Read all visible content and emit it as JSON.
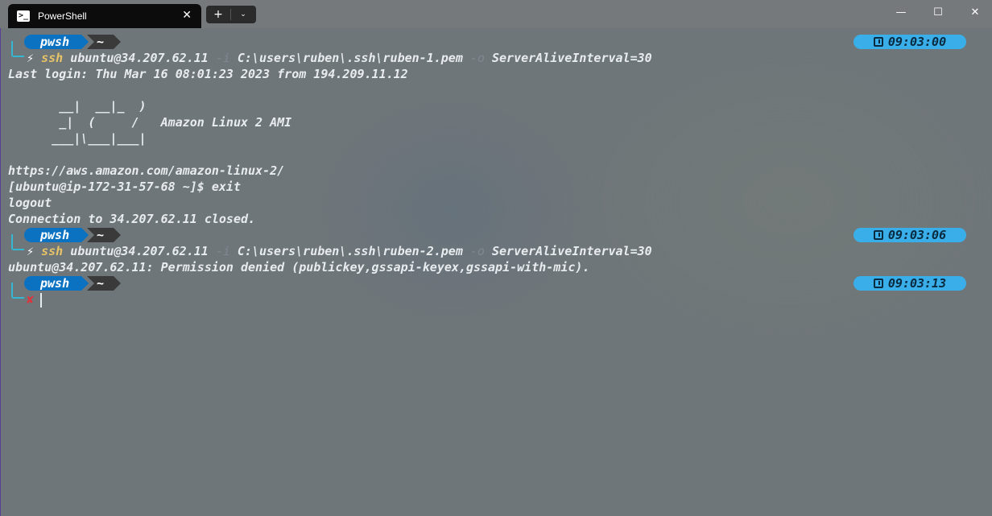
{
  "window": {
    "tab_title": "PowerShell",
    "tab_icon_glyph": ">_",
    "tab_close": "✕",
    "new_tab": "+",
    "dropdown": "⌄",
    "minimize": "—",
    "maximize": "☐",
    "close": "✕"
  },
  "prompt": {
    "shell": "pwsh",
    "path": "~",
    "ok_glyph": "⚡",
    "err_glyph": "✘"
  },
  "blocks": [
    {
      "time": "09:03:00",
      "command": {
        "name": "ssh",
        "target": "ubuntu@34.207.62.11",
        "flag1": "-i",
        "arg1": "C:\\users\\ruben\\.ssh\\ruben-1.pem",
        "flag2": "-o",
        "arg2": "ServerAliveInterval=30"
      }
    },
    {
      "time": "09:03:06",
      "command": {
        "name": "ssh",
        "target": "ubuntu@34.207.62.11",
        "flag1": "-i",
        "arg1": "C:\\users\\ruben\\.ssh\\ruben-2.pem",
        "flag2": "-o",
        "arg2": "ServerAliveInterval=30"
      }
    },
    {
      "time": "09:03:13"
    }
  ],
  "output": {
    "line1": "Last login: Thu Mar 16 08:01:23 2023 from 194.209.11.12",
    "art1": "       __|  __|_  )",
    "art2": "       _|  (     /   Amazon Linux 2 AMI",
    "art3": "      ___|\\___|___|",
    "url": "https://aws.amazon.com/amazon-linux-2/",
    "remote_prompt": "[ubuntu@ip-172-31-57-68 ~]$ exit",
    "logout": "logout",
    "closed": "Connection to 34.207.62.11 closed.",
    "denied": "ubuntu@34.207.62.11: Permission denied (publickey,gssapi-keyex,gssapi-with-mic)."
  }
}
